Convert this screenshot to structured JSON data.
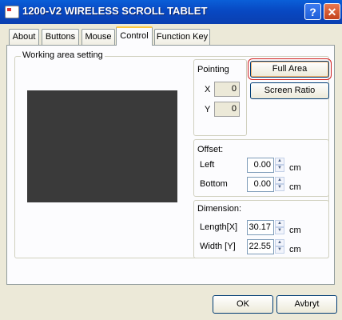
{
  "window": {
    "title": "1200-V2 WIRELESS SCROLL TABLET",
    "help_label": "?",
    "close_label": "✕"
  },
  "tabs": [
    "About",
    "Buttons",
    "Mouse",
    "Control",
    "Function Key"
  ],
  "active_tab": "Control",
  "working_area": {
    "label": "Working area setting"
  },
  "pointing": {
    "label": "Pointing",
    "x_label": "X",
    "x_value": "0",
    "y_label": "Y",
    "y_value": "0"
  },
  "buttons": {
    "full_area": "Full Area",
    "screen_ratio": "Screen Ratio",
    "ok": "OK",
    "cancel": "Avbryt"
  },
  "offset": {
    "label": "Offset:",
    "left_label": "Left",
    "left_value": "0.00",
    "left_unit": "cm",
    "bottom_label": "Bottom",
    "bottom_value": "0.00",
    "bottom_unit": "cm"
  },
  "dimension": {
    "label": "Dimension:",
    "length_label": "Length[X]",
    "length_value": "30.17",
    "length_unit": "cm",
    "width_label": "Width [Y]",
    "width_value": "22.55",
    "width_unit": "cm"
  },
  "colors": {
    "titlebar": "#0a5fd8",
    "preview": "#3a3a3a",
    "highlight": "#d02020"
  }
}
